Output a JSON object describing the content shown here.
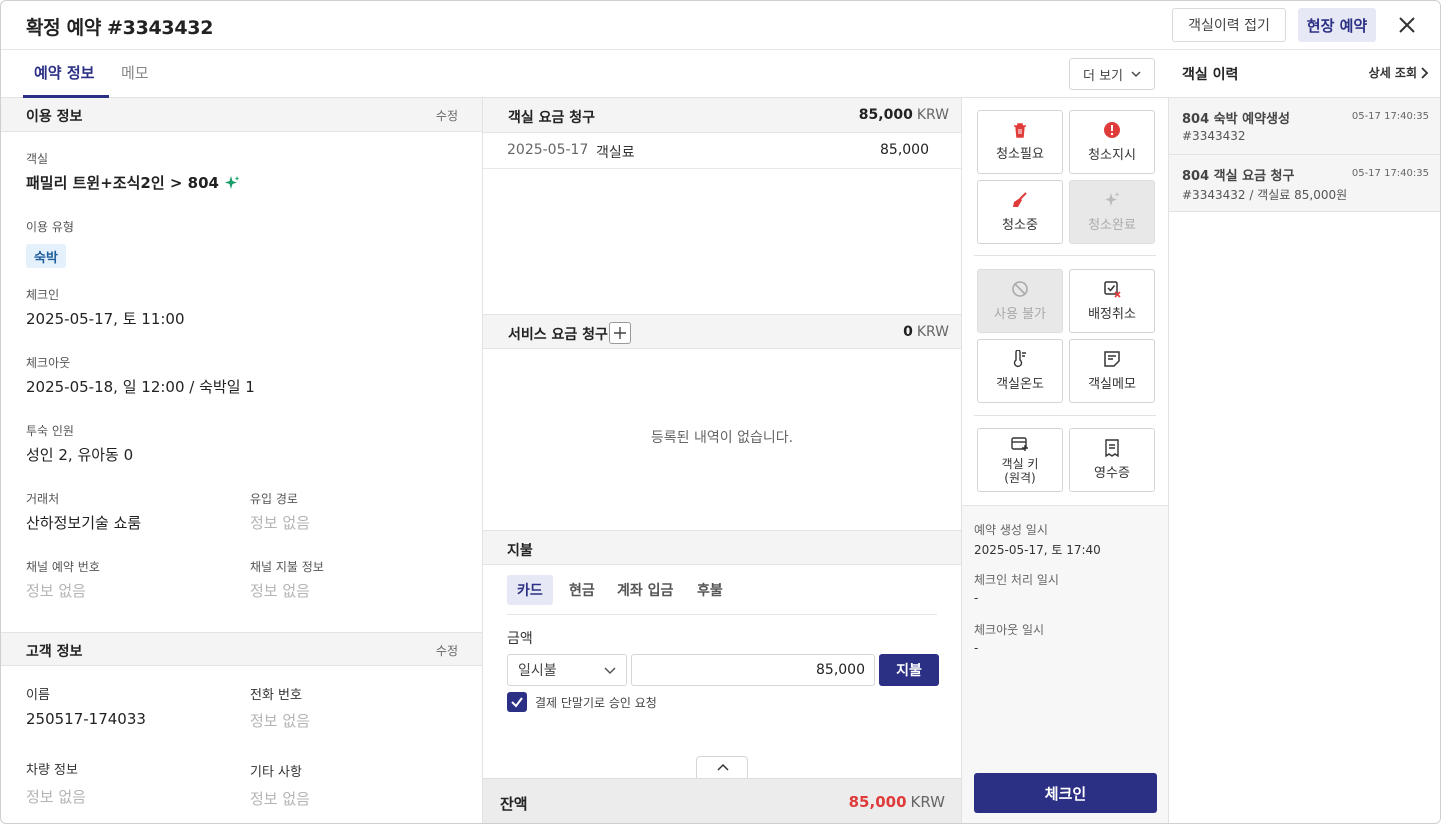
{
  "header": {
    "status": "확정 예약",
    "reservation_no": "#3343432",
    "collapse_history_label": "객실이력 접기",
    "walkin_label": "현장 예약"
  },
  "tabs": [
    {
      "label": "예약 정보",
      "active": true
    },
    {
      "label": "메모",
      "active": false
    }
  ],
  "more_button": "더 보기",
  "usage": {
    "title": "이용 정보",
    "edit": "수정",
    "room_label": "객실",
    "room_value": "패밀리 트윈+조식2인 > 804",
    "type_label": "이용 유형",
    "type_value": "숙박",
    "checkin_label": "체크인",
    "checkin_value": "2025-05-17, 토 11:00",
    "checkout_label": "체크아웃",
    "checkout_value": "2025-05-18, 일 12:00 / 숙박일 1",
    "guests_label": "투숙 인원",
    "guests_value": "성인 2, 유아동 0",
    "client_label": "거래처",
    "client_value": "산하정보기술 쇼룸",
    "source_label": "유입 경로",
    "source_value": "정보 없음",
    "channel_no_label": "채널 예약 번호",
    "channel_no_value": "정보 없음",
    "channel_pay_label": "채널 지불 정보",
    "channel_pay_value": "정보 없음"
  },
  "customer": {
    "title": "고객 정보",
    "edit": "수정",
    "name_label": "이름",
    "name_value": "250517-174033",
    "phone_label": "전화 번호",
    "phone_value": "정보 없음",
    "vehicle_label": "차량 정보",
    "vehicle_value": "정보 없음",
    "etc_label": "기타 사항",
    "etc_value": "정보 없음"
  },
  "room_charge": {
    "title": "객실 요금 청구",
    "amount": "85,000",
    "currency": "KRW",
    "rows": [
      {
        "date": "2025-05-17",
        "item": "객실료",
        "amount": "85,000"
      }
    ]
  },
  "service_charge": {
    "title": "서비스 요금 청구",
    "amount": "0",
    "currency": "KRW",
    "empty": "등록된 내역이 없습니다."
  },
  "payment": {
    "title": "지불",
    "methods": [
      "카드",
      "현금",
      "계좌 입금",
      "후불"
    ],
    "active_method": "카드",
    "amount_label": "금액",
    "installment": "일시불",
    "amount_value": "85,000",
    "pay_button": "지불",
    "terminal_check": "결제 단말기로 승인 요청",
    "terminal_checked": true
  },
  "balance": {
    "label": "잔액",
    "amount": "85,000",
    "currency": "KRW",
    "color": "#e03b3b"
  },
  "actions": {
    "clean_needed": "청소필요",
    "clean_order": "청소지시",
    "cleaning": "청소중",
    "clean_done": "청소완료",
    "unavailable": "사용 불가",
    "unassign": "배정취소",
    "room_temp": "객실온도",
    "room_memo": "객실메모",
    "room_key_line1": "객실 키",
    "room_key_line2": "(원격)",
    "receipt": "영수증"
  },
  "meta": {
    "created_label": "예약 생성 일시",
    "created_value": "2025-05-17, 토 17:40",
    "checkin_proc_label": "체크인 처리 일시",
    "checkin_proc_value": "-",
    "checkout_proc_label": "체크아웃 일시",
    "checkout_proc_value": "-"
  },
  "checkin_button": "체크인",
  "history": {
    "title": "객실 이력",
    "detail_link": "상세 조회",
    "items": [
      {
        "title": "804 숙박 예약생성",
        "sub": "#3343432",
        "time": "05-17 17:40:35"
      },
      {
        "title": "804 객실 요금 청구",
        "sub": "#3343432 / 객실료 85,000원",
        "time": "05-17 17:40:35"
      }
    ]
  },
  "colors": {
    "primary": "#2c3085",
    "accent_red": "#e03b3b",
    "badge_bg": "#e4f0fb",
    "sparkle": "#1a9e6a"
  }
}
